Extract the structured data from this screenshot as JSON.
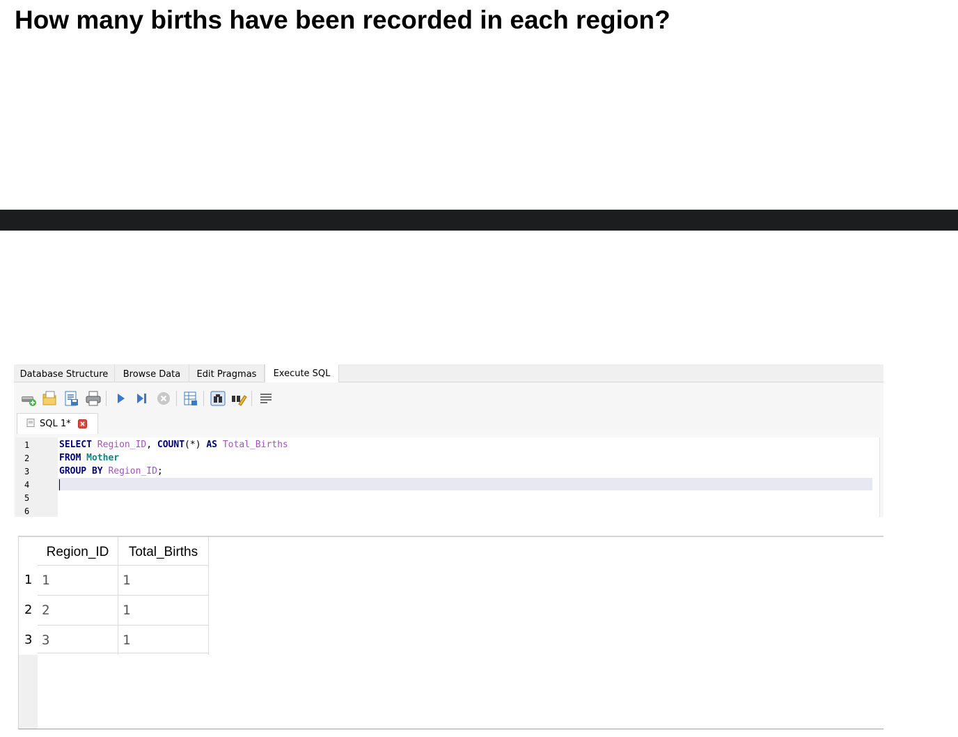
{
  "question": "How many births have been recorded in each region?",
  "tabs": [
    "Database Structure",
    "Browse Data",
    "Edit Pragmas",
    "Execute SQL"
  ],
  "active_tab": "Execute SQL",
  "toolbar": {
    "icons": [
      "open-tab-icon",
      "open-sql-file-icon",
      "save-sql-file-icon",
      "print-icon",
      "execute-all-icon",
      "execute-current-line-icon",
      "stop-execution-icon",
      "save-results-icon",
      "find-icon",
      "find-replace-icon",
      "comment-icon"
    ]
  },
  "sql_tab": {
    "label": "SQL 1*"
  },
  "editor": {
    "line_numbers": [
      "1",
      "2",
      "3",
      "4",
      "5",
      "6"
    ],
    "lines": [
      [
        {
          "t": "SELECT",
          "c": "kw"
        },
        {
          "t": " ",
          "c": "punct"
        },
        {
          "t": "Region_ID",
          "c": "ident"
        },
        {
          "t": ", ",
          "c": "punct"
        },
        {
          "t": "COUNT",
          "c": "kw"
        },
        {
          "t": "(*) ",
          "c": "punct"
        },
        {
          "t": "AS",
          "c": "kw"
        },
        {
          "t": " ",
          "c": "punct"
        },
        {
          "t": "Total_Births",
          "c": "ident"
        }
      ],
      [
        {
          "t": "FROM",
          "c": "kw"
        },
        {
          "t": " ",
          "c": "punct"
        },
        {
          "t": "Mother",
          "c": "tbl"
        }
      ],
      [
        {
          "t": "GROUP BY",
          "c": "kw"
        },
        {
          "t": " ",
          "c": "punct"
        },
        {
          "t": "Region_ID",
          "c": "ident"
        },
        {
          "t": ";",
          "c": "punct"
        }
      ]
    ]
  },
  "results": {
    "columns": [
      "Region_ID",
      "Total_Births"
    ],
    "row_numbers": [
      "1",
      "2",
      "3"
    ],
    "rows": [
      [
        "1",
        "1"
      ],
      [
        "2",
        "1"
      ],
      [
        "3",
        "1"
      ]
    ]
  }
}
